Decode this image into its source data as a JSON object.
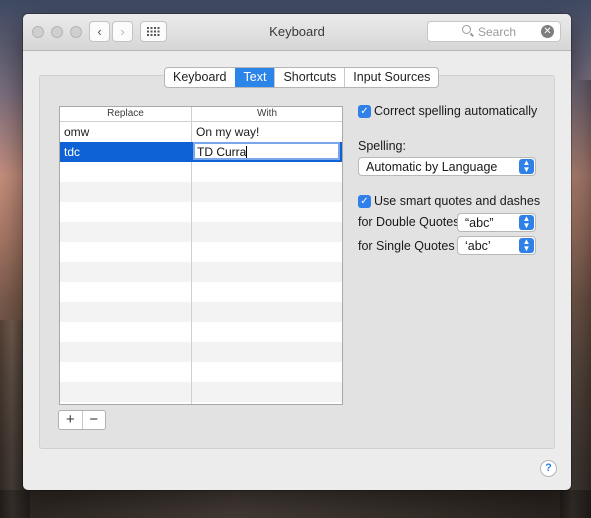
{
  "window": {
    "title": "Keyboard",
    "search_placeholder": "Search"
  },
  "icons": {
    "back": "‹",
    "forward": "›",
    "grid": "grid-icon",
    "clear": "✕",
    "check": "✓",
    "updown": "▲▼"
  },
  "tabs": [
    {
      "label": "Keyboard"
    },
    {
      "label": "Text",
      "active": true
    },
    {
      "label": "Shortcuts"
    },
    {
      "label": "Input Sources"
    }
  ],
  "table": {
    "headers": {
      "replace": "Replace",
      "with": "With"
    },
    "rows": [
      {
        "replace": "omw",
        "with": "On my way!"
      },
      {
        "replace": "tdc",
        "with": "TD Curra",
        "selected": true,
        "editing": true
      }
    ]
  },
  "buttons": {
    "add": "+",
    "remove": "−"
  },
  "options": {
    "correct_spelling": {
      "label": "Correct spelling automatically",
      "checked": true
    },
    "spelling_label": "Spelling:",
    "spelling_value": "Automatic by Language",
    "smart_quotes": {
      "label": "Use smart quotes and dashes",
      "checked": true
    },
    "double_quotes_label": "for Double Quotes",
    "double_quotes_value": "“abc”",
    "single_quotes_label": "for Single Quotes",
    "single_quotes_value": "‘abc’"
  },
  "help": "?",
  "colors": {
    "accent": "#2b84e8",
    "selection": "#0f62d5"
  }
}
